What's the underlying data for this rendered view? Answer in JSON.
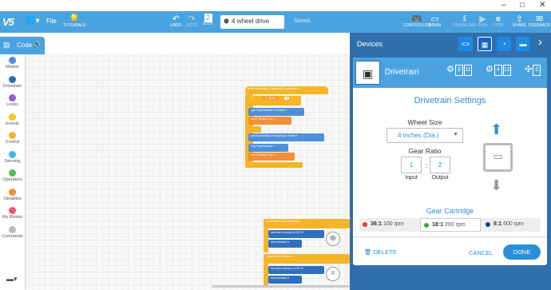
{
  "window": {
    "minimize": "–",
    "maximize": "□",
    "close": "✕"
  },
  "topbar": {
    "logo": "V5",
    "file": "File",
    "tutorials": "TUTORIALS",
    "undo": "UNDO",
    "redo": "REDO",
    "slot": "SLOT",
    "slot_number": "2",
    "project_name": "4 wheel drive",
    "saved": "Saved",
    "controller": "CONTROLLER",
    "brain": "BRAIN",
    "download": "DOWNLOAD",
    "run": "RUN",
    "stop": "STOP",
    "share": "SHARE",
    "feedback": "FEEDBACK"
  },
  "code_tab": {
    "label": "Code"
  },
  "categories": [
    {
      "label": "Motion",
      "color": "#4a90e2"
    },
    {
      "label": "Drivetrain",
      "color": "#2f6fab"
    },
    {
      "label": "Looks",
      "color": "#9b59d0"
    },
    {
      "label": "Events",
      "color": "#f5c518"
    },
    {
      "label": "Control",
      "color": "#f5b527"
    },
    {
      "label": "Sensing",
      "color": "#3fbad8"
    },
    {
      "label": "Operators",
      "color": "#52c152"
    },
    {
      "label": "Variables",
      "color": "#f68e36"
    },
    {
      "label": "My Blocks",
      "color": "#e8586f"
    },
    {
      "label": "Comments",
      "color": "#bdbdbd"
    }
  ],
  "blocks": {
    "when_controller": "when Controller1 ▾ button R1 ▾ pressed ▾",
    "if_block": "if",
    "r1_button": "R_Button",
    "val1": "1",
    "spin": "spin  FlywheelBar ▾ forward ▾",
    "set1": "set  R_Button ▾ to 0",
    "set_vel": "set  FlywheelBar ▾ stopping to brake ▾",
    "stop": "stop  FlywheelBar ▾",
    "set2": "set  R_Button ▾ to 1",
    "ctrl_axis1": "Controller1 ▾ Up ▾ pressed?",
    "drive_vel1": "set drive velocity to 100 %",
    "drive1": "drive forward ▾",
    "ctrl_axis2": "Controller1 ▾ Down ▾",
    "drive_vel2": "set drive velocity to 100 %",
    "drive2": "drive forward ▾"
  },
  "devices": {
    "title": "Devices",
    "device_name": "Drivetrain",
    "ports": {
      "left": [
        "3",
        "11"
      ],
      "right": [
        "4",
        "12"
      ],
      "gyro": "2"
    },
    "settings_title": "Drivetrain Settings",
    "wheel_size_label": "Wheel Size",
    "wheel_size_value": "4 inches (Dia.)",
    "gear_ratio_label": "Gear Ratio",
    "input_value": "1",
    "output_value": "2",
    "input_label": "Input",
    "output_label": "Output",
    "ratio_sep": ":",
    "cartridge_title": "Gear Cartridge",
    "cartridges": [
      {
        "ratio": "36:1",
        "rpm": "100 rpm",
        "color": "#e53935",
        "selected": false
      },
      {
        "ratio": "18:1",
        "rpm": "200 rpm",
        "color": "#43a047",
        "selected": true
      },
      {
        "ratio": "6:1",
        "rpm": "600 rpm",
        "color": "#1e3a8a",
        "selected": false
      }
    ],
    "delete": "DELETE",
    "cancel": "CANCEL",
    "done": "DONE"
  },
  "zoom": {
    "in": "⊕",
    "reset": "="
  }
}
